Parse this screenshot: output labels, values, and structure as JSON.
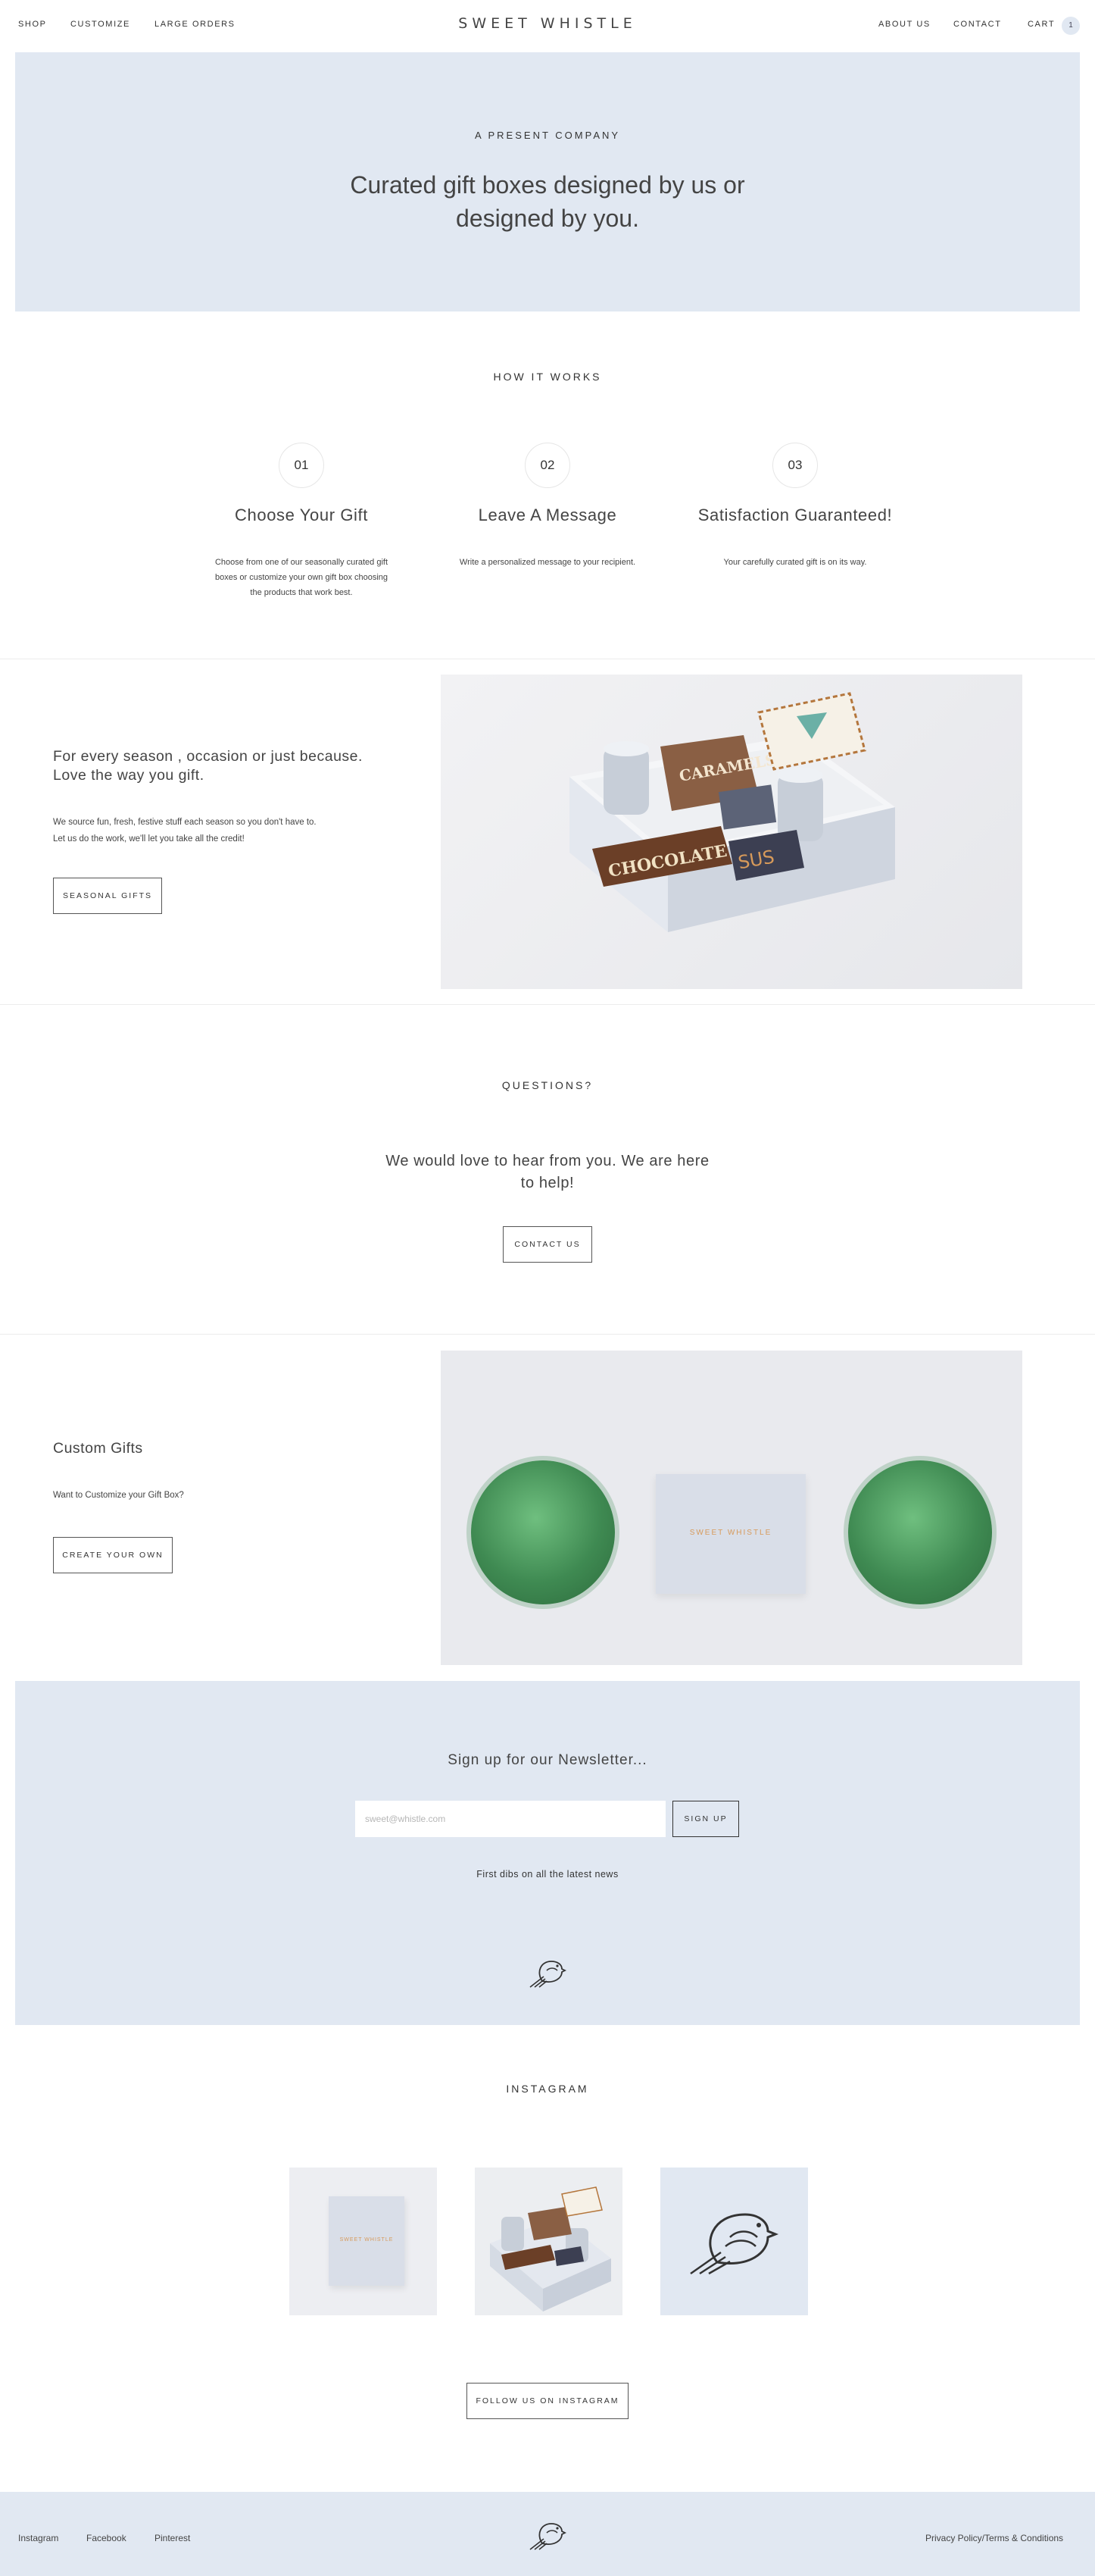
{
  "header": {
    "nav_left": [
      "SHOP",
      "CUSTOMIZE",
      "LARGE ORDERS"
    ],
    "logo": "SWEET WHISTLE",
    "nav_right": [
      "ABOUT US",
      "CONTACT",
      "CART"
    ],
    "cart_count": "1"
  },
  "hero": {
    "eyebrow": "A PRESENT COMPANY",
    "headline_line1": "Curated gift boxes designed by us or",
    "headline_line2": "designed by you."
  },
  "how_it_works": {
    "heading": "HOW IT WORKS",
    "steps": [
      {
        "number": "01",
        "title": "Choose Your Gift",
        "desc_line1": "Choose from one of our seasonally curated gift",
        "desc_line2": "boxes or customize your own gift box choosing",
        "desc_line3": "the products that work best."
      },
      {
        "number": "02",
        "title": "Leave A Message",
        "desc_line1": "Write a personalized message to your recipient."
      },
      {
        "number": "03",
        "title": "Satisfaction Guaranteed!",
        "desc_line1": "Your carefully curated gift is on its way."
      }
    ]
  },
  "seasonal": {
    "headline_line1": "For every season , occasion or just because.",
    "headline_line2": "Love the way you gift.",
    "body_line1": "We source fun, fresh, festive stuff each season so you don't have to.",
    "body_line2": "Let us do the work, we'll let you take all the credit!",
    "button": "SEASONAL GIFTS",
    "image_labels": {
      "caramels": "CARAMELS",
      "chocolate": "CHOCOLATE",
      "sus": "SUS"
    }
  },
  "questions": {
    "heading": "QUESTIONS?",
    "text_line1": "We would love to hear from you. We are here",
    "text_line2": "to help!",
    "button": "CONTACT US"
  },
  "custom": {
    "headline": "Custom Gifts",
    "body": "Want to Customize your Gift Box?",
    "button": "CREATE YOUR OWN",
    "box_label": "SWEET WHISTLE"
  },
  "newsletter": {
    "heading": "Sign up for our Newsletter...",
    "email_placeholder": "sweet@whistle.com",
    "button": "SIGN UP",
    "tagline": "First dibs on all the latest news"
  },
  "instagram": {
    "heading": "INSTAGRAM",
    "box_label": "SWEET WHISTLE",
    "button": "FOLLOW US ON INSTAGRAM"
  },
  "footer": {
    "links": [
      "Instagram",
      "Facebook",
      "Pinterest"
    ],
    "legal": "Privacy Policy/Terms & Conditions"
  },
  "colors": {
    "band_blue": "#e1e8f2",
    "text": "#333333",
    "box_label_orange": "#d79a5a",
    "plant_green": "#3f8a52"
  }
}
